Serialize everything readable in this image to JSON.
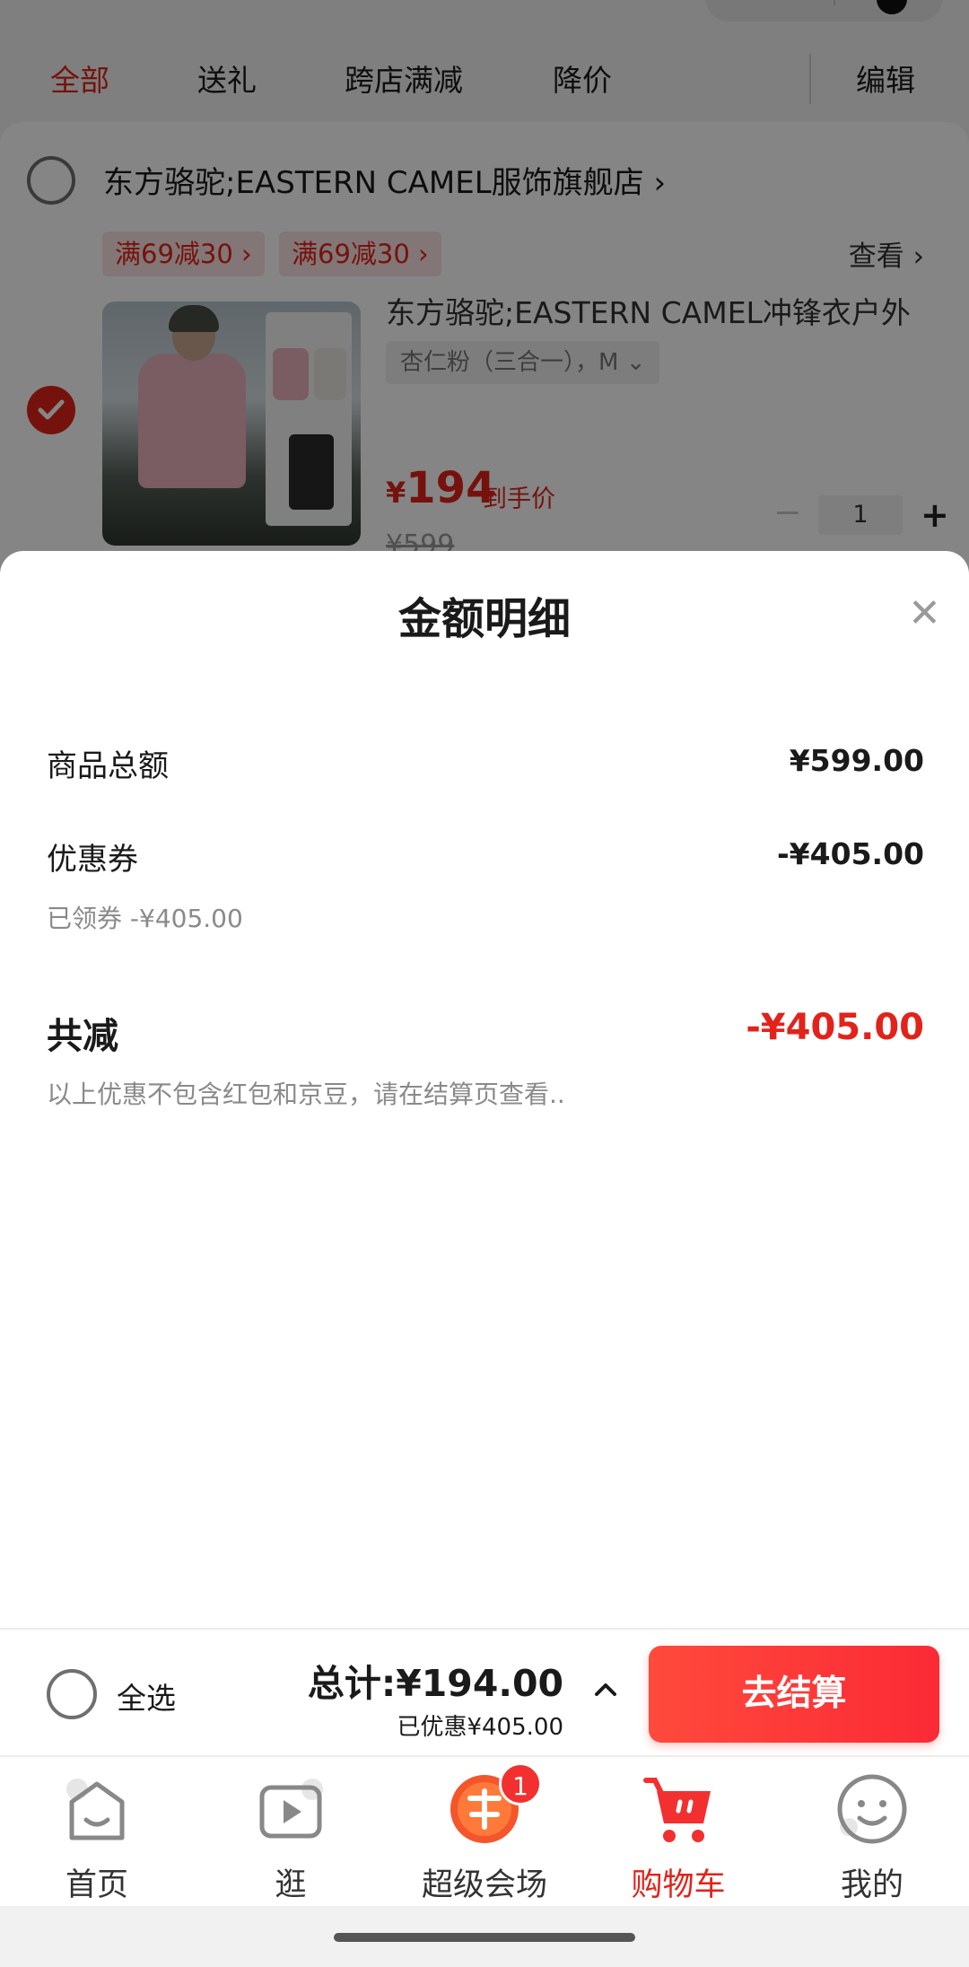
{
  "filter_tabs": [
    "全部",
    "送礼",
    "跨店满减",
    "降价"
  ],
  "filter_edit": "编辑",
  "shop": {
    "name": "东方骆驼;EASTERN CAMEL服饰旗舰店 ›",
    "promos": [
      "满69减30 ›",
      "满69减30 ›"
    ],
    "check_link": "查看 ›"
  },
  "product": {
    "title": "东方骆驼;EASTERN CAMEL冲锋衣户外",
    "sku": "杏仁粉（三合一），M ⌄",
    "price_currency": "¥",
    "price_value": "194",
    "price_label": "到手价",
    "old_price": "¥599",
    "quantity": "1"
  },
  "sheet": {
    "title": "金额明细",
    "close_icon": "close-icon",
    "goods_total_label": "商品总额",
    "goods_total_value": "¥599.00",
    "coupon_label": "优惠券",
    "coupon_value": "-¥405.00",
    "coupon_note": "已领券 -¥405.00",
    "total_reduce_label": "共减",
    "total_reduce_value": "-¥405.00",
    "footnote": "以上优惠不包含红包和京豆，请在结算页查看.."
  },
  "checkout": {
    "select_all": "全选",
    "total": "总计:¥194.00",
    "saved": "已优惠¥405.00",
    "button": "去结算"
  },
  "tabbar": [
    {
      "label": "首页",
      "icon": "home-icon"
    },
    {
      "label": "逛",
      "icon": "play-icon"
    },
    {
      "label": "超级会场",
      "icon": "promo-icon",
      "badge": "1"
    },
    {
      "label": "购物车",
      "icon": "cart-icon",
      "active": true
    },
    {
      "label": "我的",
      "icon": "smile-icon"
    }
  ],
  "colors": {
    "accent": "#e2231a",
    "button": "#fb2a35"
  }
}
